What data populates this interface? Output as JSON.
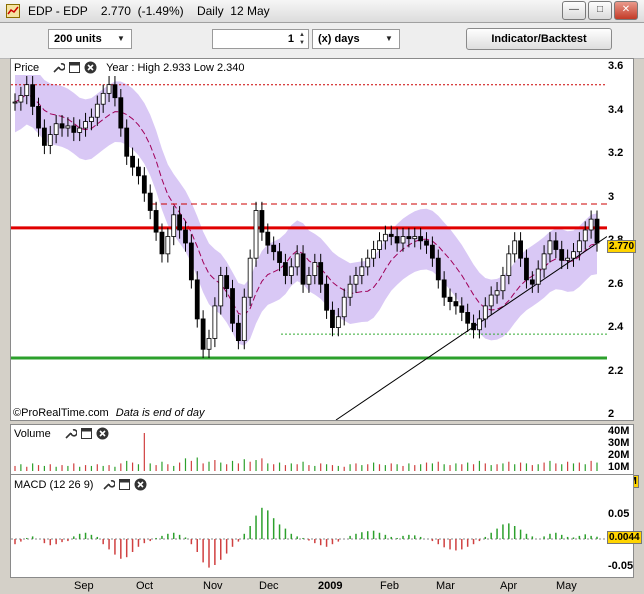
{
  "window": {
    "title": "EDP - EDP    2.770  (-1.49%)    Daily  12 May"
  },
  "toolbar": {
    "units_select": "200 units",
    "period_value": "1",
    "period_unit_select": "(x) days",
    "indicator_button": "Indicator/Backtest"
  },
  "price_panel": {
    "label": "Price",
    "year_info": "Year : High 2.933 Low 2.340",
    "footer_brand": "©ProRealTime.com",
    "footer_note": "Data is end of day",
    "y_ticks": [
      "3.6",
      "3.4",
      "3.2",
      "3",
      "2.8",
      "2.6",
      "2.4",
      "2.2",
      "2"
    ],
    "last_value": "2.770",
    "colors": {
      "resistance": "#e00000",
      "support": "#2ca02c",
      "band": "#d9c8f5",
      "ma": "#a0005a"
    }
  },
  "volume_panel": {
    "label": "Volume",
    "y_ticks": [
      "40M",
      "30M",
      "20M",
      "10M"
    ],
    "last_value": "10.2M"
  },
  "macd_panel": {
    "label": "MACD (12 26 9)",
    "y_ticks": [
      "0.05",
      "0",
      "-0.05"
    ],
    "last_value": "0.0044"
  },
  "x_axis": [
    "Sep",
    "Oct",
    "Nov",
    "Dec",
    "2009",
    "Feb",
    "Mar",
    "Apr",
    "May"
  ],
  "chart_data": {
    "type": "candlestick",
    "price_y_range": [
      2.0,
      3.6
    ],
    "horizontal_lines": {
      "resistance": 2.84,
      "support": 2.24,
      "dashed_high": 2.95,
      "dotted_top": 3.5,
      "dotted_low": 2.35
    },
    "close_series": [
      3.42,
      3.45,
      3.5,
      3.4,
      3.3,
      3.22,
      3.27,
      3.32,
      3.3,
      3.31,
      3.28,
      3.3,
      3.33,
      3.35,
      3.41,
      3.46,
      3.5,
      3.44,
      3.3,
      3.17,
      3.12,
      3.08,
      3.0,
      2.92,
      2.82,
      2.72,
      2.8,
      2.9,
      2.83,
      2.77,
      2.6,
      2.42,
      2.28,
      2.33,
      2.48,
      2.62,
      2.56,
      2.4,
      2.32,
      2.52,
      2.7,
      2.92,
      2.82,
      2.76,
      2.73,
      2.68,
      2.62,
      2.66,
      2.72,
      2.58,
      2.62,
      2.68,
      2.58,
      2.46,
      2.38,
      2.43,
      2.52,
      2.58,
      2.62,
      2.66,
      2.7,
      2.74,
      2.78,
      2.81,
      2.8,
      2.77,
      2.8,
      2.79,
      2.8,
      2.78,
      2.76,
      2.7,
      2.6,
      2.52,
      2.5,
      2.48,
      2.45,
      2.4,
      2.37,
      2.42,
      2.48,
      2.53,
      2.55,
      2.62,
      2.72,
      2.78,
      2.7,
      2.6,
      2.58,
      2.65,
      2.72,
      2.78,
      2.74,
      2.69,
      2.7,
      2.73,
      2.78,
      2.83,
      2.88,
      2.77
    ],
    "volume_series": [
      6,
      8,
      5,
      9,
      7,
      6,
      8,
      5,
      7,
      6,
      9,
      5,
      7,
      6,
      8,
      6,
      7,
      5,
      9,
      12,
      10,
      8,
      45,
      9,
      7,
      11,
      8,
      6,
      10,
      15,
      12,
      16,
      9,
      11,
      13,
      10,
      8,
      12,
      9,
      14,
      11,
      13,
      15,
      9,
      8,
      10,
      7,
      9,
      8,
      11,
      7,
      6,
      9,
      8,
      7,
      6,
      5,
      8,
      9,
      7,
      8,
      10,
      8,
      7,
      9,
      8,
      6,
      9,
      7,
      8,
      10,
      9,
      11,
      8,
      7,
      9,
      8,
      10,
      8,
      12,
      9,
      7,
      8,
      9,
      11,
      8,
      10,
      9,
      7,
      8,
      10,
      12,
      9,
      8,
      11,
      9,
      10,
      8,
      12,
      10
    ],
    "macd_series": [
      -0.01,
      -0.005,
      0.002,
      0.005,
      0.0,
      -0.008,
      -0.012,
      -0.01,
      -0.006,
      -0.004,
      0.005,
      0.01,
      0.012,
      0.008,
      0.004,
      -0.01,
      -0.02,
      -0.03,
      -0.038,
      -0.035,
      -0.025,
      -0.015,
      -0.008,
      -0.004,
      0.002,
      0.006,
      0.01,
      0.012,
      0.008,
      0.003,
      -0.01,
      -0.025,
      -0.045,
      -0.055,
      -0.05,
      -0.04,
      -0.028,
      -0.015,
      -0.005,
      0.01,
      0.025,
      0.045,
      0.06,
      0.055,
      0.04,
      0.028,
      0.02,
      0.01,
      0.005,
      0.002,
      -0.003,
      -0.008,
      -0.012,
      -0.015,
      -0.01,
      -0.005,
      0.0,
      0.006,
      0.01,
      0.013,
      0.015,
      0.016,
      0.012,
      0.008,
      0.004,
      0.002,
      0.006,
      0.008,
      0.007,
      0.004,
      0.0,
      -0.004,
      -0.01,
      -0.016,
      -0.02,
      -0.022,
      -0.02,
      -0.015,
      -0.01,
      -0.004,
      0.004,
      0.012,
      0.02,
      0.028,
      0.03,
      0.025,
      0.018,
      0.01,
      0.005,
      0.0,
      0.005,
      0.01,
      0.012,
      0.008,
      0.004,
      0.003,
      0.006,
      0.009,
      0.006,
      0.0044
    ]
  }
}
